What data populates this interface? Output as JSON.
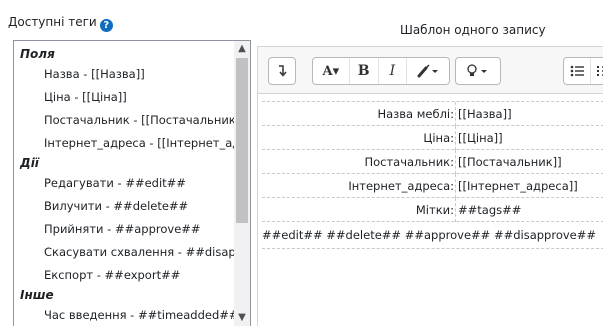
{
  "available_tags": {
    "label": "Доступні теги",
    "help_icon": "question-circle-icon",
    "groups": [
      {
        "name": "Поля",
        "items": [
          "Назва - [[Назва]]",
          "Ціна - [[Ціна]]",
          "Постачальник - [[Постачальник]]",
          "Інтернет_адреса - [[Інтернет_адреса]]"
        ]
      },
      {
        "name": "Дії",
        "items": [
          "Редагувати - ##edit##",
          "Вилучити - ##delete##",
          "Прийняти - ##approve##",
          "Скасувати схвалення - ##disapprove##",
          "Експорт - ##export##"
        ]
      },
      {
        "name": "Інше",
        "items": [
          "Час введення - ##timeadded##"
        ]
      }
    ]
  },
  "template": {
    "label": "Шаблон одного запису",
    "toolbar": {
      "collapse_icon": "collapse-toolbar-icon",
      "font_label": "A▾",
      "bold_label": "B",
      "italic_label": "I",
      "brush_icon": "paintbrush-icon",
      "bulb_icon": "lightbulb-icon",
      "unordered_list_icon": "bullet-list-icon",
      "ordered_list_icon": "numbered-list-icon"
    },
    "rows": [
      {
        "label": "Назва меблі:",
        "value": "[[Назва]]"
      },
      {
        "label": "Ціна:",
        "value": "[[Ціна]]"
      },
      {
        "label": "Постачальник:",
        "value": "[[Постачальник]]"
      },
      {
        "label": "Інтернет_адреса:",
        "value": "[[Інтернет_адреса]]"
      },
      {
        "label": "Мітки:",
        "value": "##tags##"
      }
    ],
    "actions_line": "##edit## ##delete## ##approve## ##disapprove##"
  }
}
